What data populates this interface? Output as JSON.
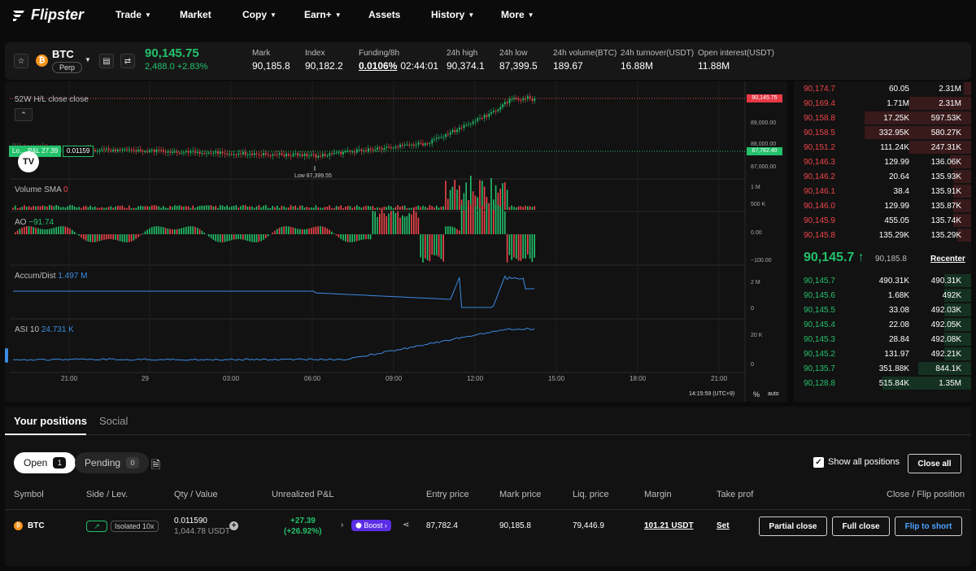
{
  "nav": {
    "logo": "Flipster",
    "items": [
      {
        "label": "Trade",
        "caret": true
      },
      {
        "label": "Market",
        "caret": false
      },
      {
        "label": "Copy",
        "caret": true
      },
      {
        "label": "Earn+",
        "caret": true
      },
      {
        "label": "Assets",
        "caret": false
      },
      {
        "label": "History",
        "caret": true
      },
      {
        "label": "More",
        "caret": true
      }
    ]
  },
  "ticker": {
    "symbol": "BTC",
    "type": "Perp",
    "last_price": "90,145.75",
    "change": "2,488.0 +2.83%",
    "stats": [
      {
        "label": "Mark",
        "value": "90,185.8"
      },
      {
        "label": "Index",
        "value": "90,182.2"
      },
      {
        "label": "Funding/8h",
        "value": "0.0106%",
        "extra": "02:44:01"
      },
      {
        "label": "24h high",
        "value": "90,374.1"
      },
      {
        "label": "24h low",
        "value": "87,399.5"
      },
      {
        "label": "24h volume(BTC)",
        "value": "189.67"
      },
      {
        "label": "24h turnover(USDT)",
        "value": "16.88M"
      },
      {
        "label": "Open interest(USDT)",
        "value": "11.88M"
      }
    ]
  },
  "chart": {
    "study_52w": "52W H/L close close",
    "pos_label": "Lo… P&L 27.39",
    "pos_qty": "0.01159",
    "low_marker": "Low 87,399.55",
    "price_tag": "90,145.75",
    "entry_tag": "87,782.40",
    "price_scale": [
      "89,000.00",
      "88,000.00",
      "87,000.00"
    ],
    "volume": {
      "label": "Volume SMA",
      "value": "0",
      "scale": [
        "1 M",
        "500 K"
      ]
    },
    "ao": {
      "label": "AO",
      "value": "−91.74",
      "scale": [
        "0.00",
        "−100.00"
      ]
    },
    "accum": {
      "label": "Accum/Dist",
      "value": "1.497 M",
      "scale": [
        "2 M",
        "0"
      ]
    },
    "asi": {
      "label": "ASI 10",
      "value": "24.731 K",
      "scale": [
        "20 K",
        "0"
      ]
    },
    "time_axis": [
      "21:00",
      "29",
      "03:00",
      "06:00",
      "09:00",
      "12:00",
      "15:00",
      "18:00",
      "21:00"
    ],
    "clock": "14:15:59 (UTC+9)",
    "pct": "%",
    "auto": "auto",
    "colors": {
      "up": "#23c16b",
      "down": "#f0454a",
      "line": "#3b8be0"
    }
  },
  "orderbook": {
    "asks": [
      [
        "90,174.7",
        "60.05",
        "2.31M"
      ],
      [
        "90,169.4",
        "1.71M",
        "2.31M"
      ],
      [
        "90,158.8",
        "17.25K",
        "597.53K"
      ],
      [
        "90,158.5",
        "332.95K",
        "580.27K"
      ],
      [
        "90,151.2",
        "111.24K",
        "247.31K"
      ],
      [
        "90,146.3",
        "129.99",
        "136.06K"
      ],
      [
        "90,146.2",
        "20.64",
        "135.93K"
      ],
      [
        "90,146.1",
        "38.4",
        "135.91K"
      ],
      [
        "90,146.0",
        "129.99",
        "135.87K"
      ],
      [
        "90,145.9",
        "455.05",
        "135.74K"
      ],
      [
        "90,145.8",
        "135.29K",
        "135.29K"
      ]
    ],
    "mid_price": "90,145.7",
    "mid_arrow": "↑",
    "mark": "90,185.8",
    "recenter": "Recenter",
    "bids": [
      [
        "90,145.7",
        "490.31K",
        "490.31K"
      ],
      [
        "90,145.6",
        "1.68K",
        "492K"
      ],
      [
        "90,145.5",
        "33.08",
        "492.03K"
      ],
      [
        "90,145.4",
        "22.08",
        "492.05K"
      ],
      [
        "90,145.3",
        "28.84",
        "492.08K"
      ],
      [
        "90,145.2",
        "131.97",
        "492.21K"
      ],
      [
        "90,135.7",
        "351.88K",
        "844.1K"
      ],
      [
        "90,128.8",
        "515.84K",
        "1.35M"
      ]
    ]
  },
  "positions": {
    "tabs": [
      "Your positions",
      "Social"
    ],
    "open_label": "Open",
    "open_count": "1",
    "pending_label": "Pending",
    "pending_count": "0",
    "show_all": "Show all positions",
    "close_all": "Close all",
    "headers": [
      "Symbol",
      "Side / Lev.",
      "Qty / Value",
      "Unrealized P&L",
      "Entry price",
      "Mark price",
      "Liq. price",
      "Margin",
      "Take prof",
      "Close / Flip position"
    ],
    "row": {
      "symbol": "BTC",
      "side_icon": "↗",
      "leverage": "Isolated 10x",
      "qty": "0.011590",
      "value": "1,044.78 USDT",
      "pnl": "+27.39",
      "pnl_pct": "(+26.92%)",
      "boost": "Boost",
      "entry": "87,782.4",
      "mark": "90,185.8",
      "liq": "79,446.9",
      "margin": "101.21 USDT",
      "tp": "Set",
      "partial": "Partial close",
      "full": "Full close",
      "flip": "Flip to short"
    }
  }
}
